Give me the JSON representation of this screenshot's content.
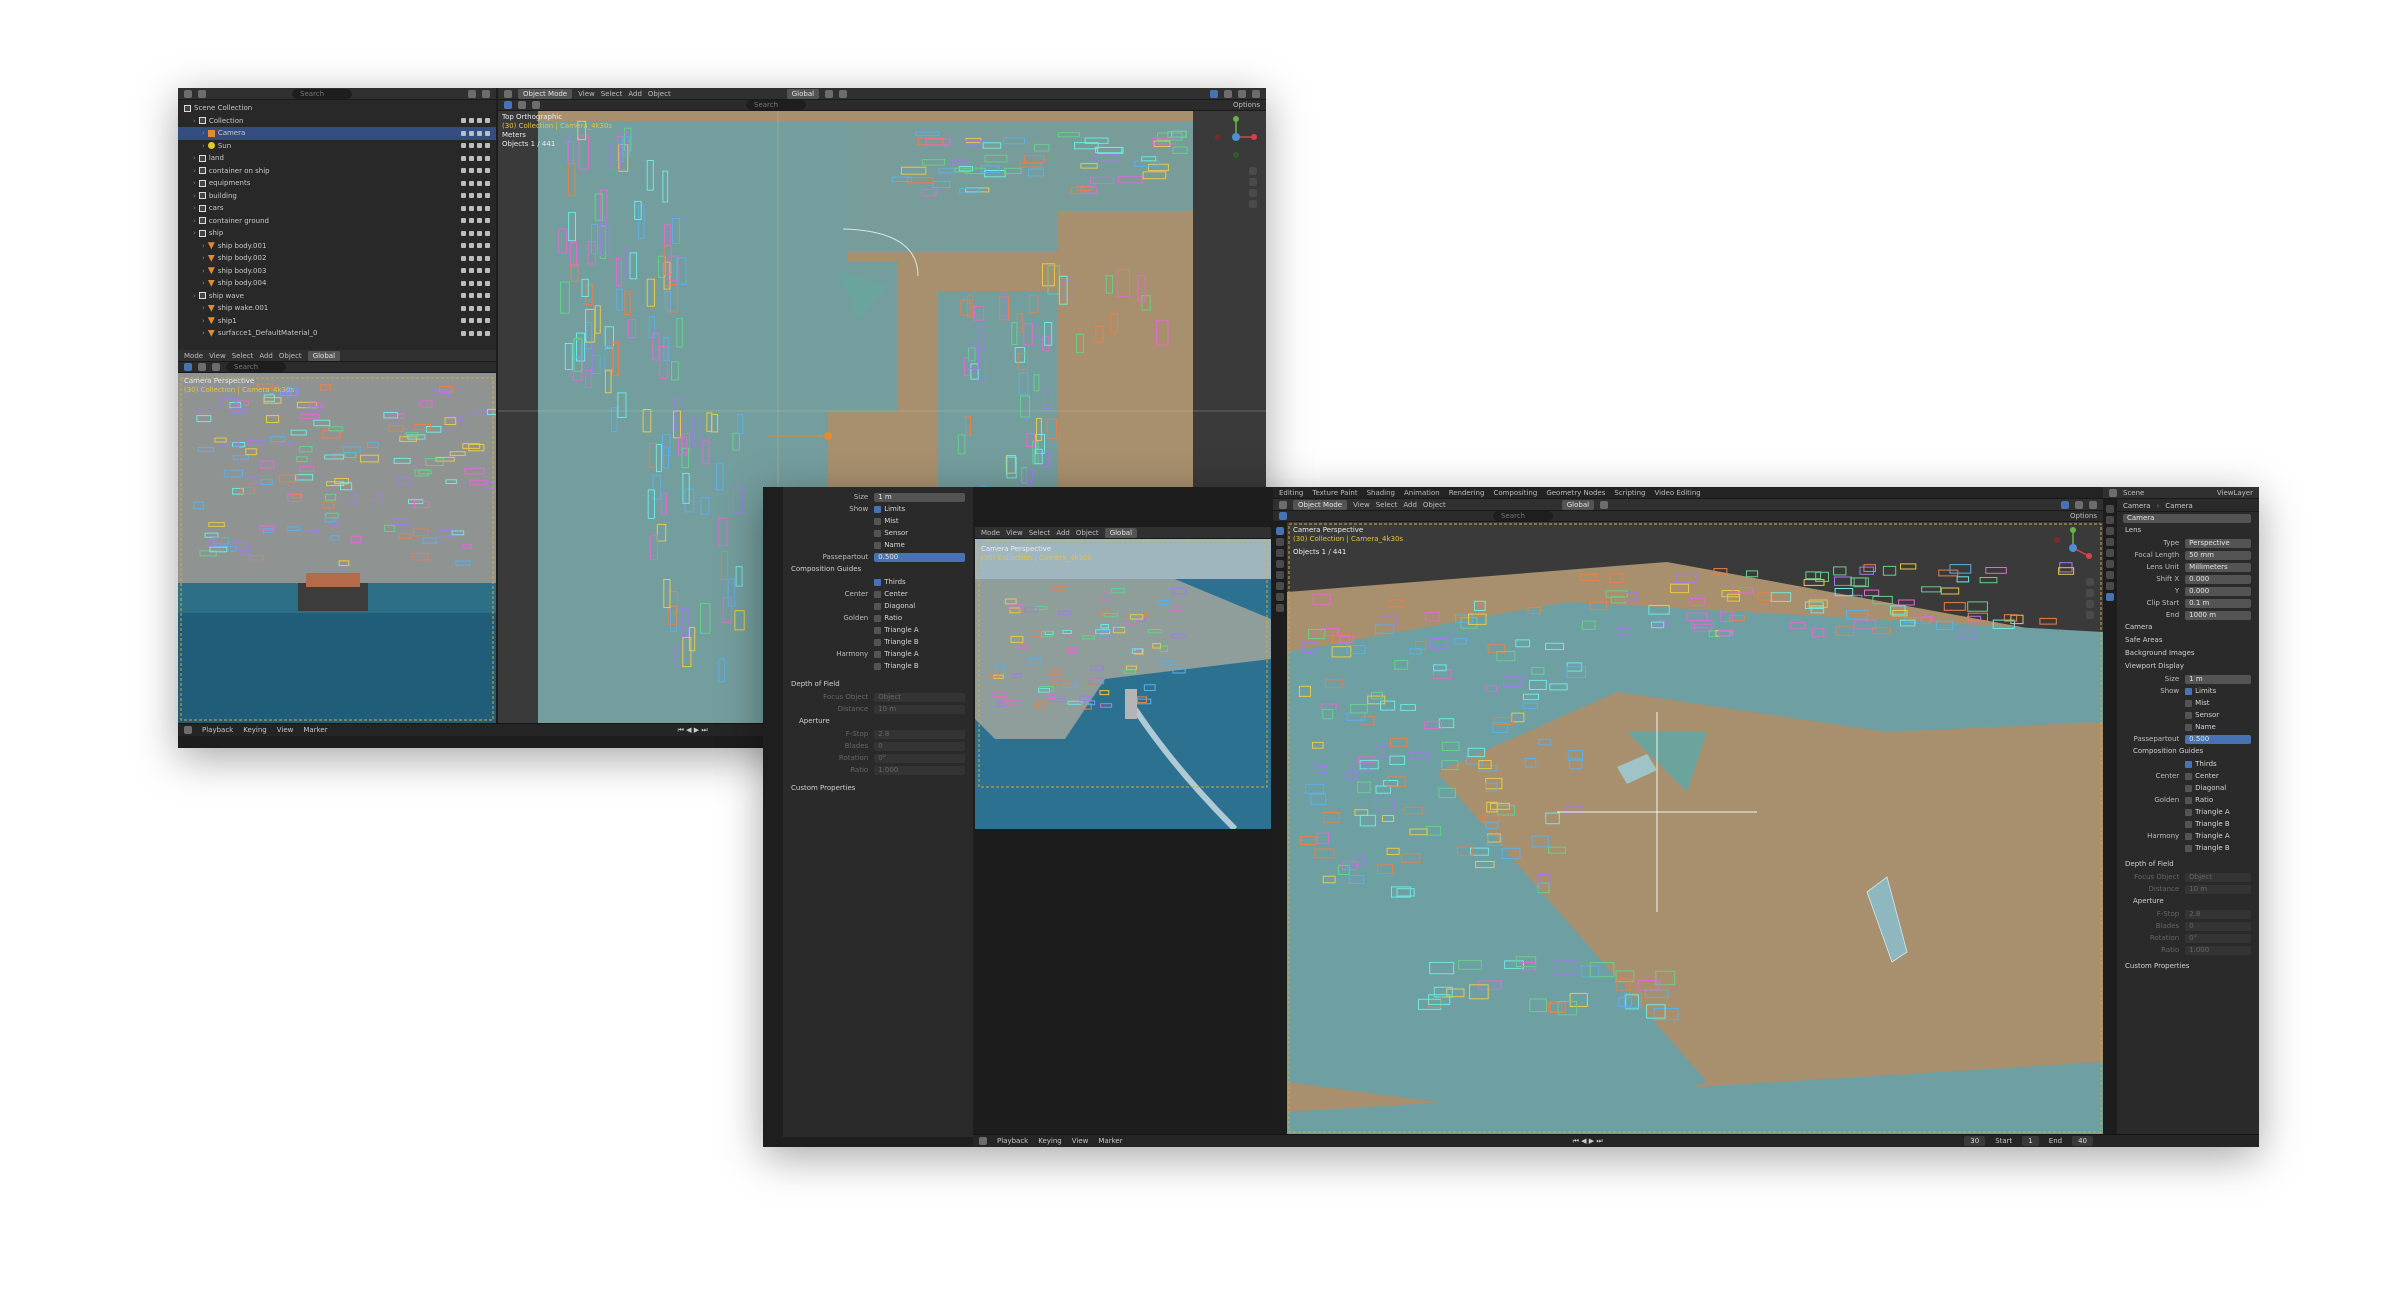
{
  "topbar": {
    "mode": "Object Mode",
    "menu": [
      "View",
      "Select",
      "Add",
      "Object"
    ],
    "orientation": "Global",
    "options": "Options",
    "search_placeholder": "Search"
  },
  "workspace_tabs": [
    "Editing",
    "Texture Paint",
    "Shading",
    "Animation",
    "Rendering",
    "Compositing",
    "Geometry Nodes",
    "Scripting",
    "Video Editing"
  ],
  "outliner": {
    "root": "Scene Collection",
    "items": [
      {
        "label": "Collection",
        "kind": "col",
        "depth": 1
      },
      {
        "label": "Camera",
        "kind": "cam",
        "depth": 2,
        "selected": true
      },
      {
        "label": "Sun",
        "kind": "sun",
        "depth": 2
      },
      {
        "label": "land",
        "kind": "col",
        "depth": 1
      },
      {
        "label": "container on ship",
        "kind": "col",
        "depth": 1
      },
      {
        "label": "equipments",
        "kind": "col",
        "depth": 1
      },
      {
        "label": "building",
        "kind": "col",
        "depth": 1
      },
      {
        "label": "cars",
        "kind": "col",
        "depth": 1
      },
      {
        "label": "container ground",
        "kind": "col",
        "depth": 1
      },
      {
        "label": "ship",
        "kind": "col",
        "depth": 1
      },
      {
        "label": "ship body.001",
        "kind": "obj",
        "depth": 2
      },
      {
        "label": "ship body.002",
        "kind": "obj",
        "depth": 2
      },
      {
        "label": "ship body.003",
        "kind": "obj",
        "depth": 2
      },
      {
        "label": "ship body.004",
        "kind": "obj",
        "depth": 2
      },
      {
        "label": "ship wave",
        "kind": "col",
        "depth": 1
      },
      {
        "label": "ship wake.001",
        "kind": "obj",
        "depth": 2
      },
      {
        "label": "ship1",
        "kind": "obj",
        "depth": 2
      },
      {
        "label": "surfacce1_DefaultMaterial_0",
        "kind": "obj",
        "depth": 2
      }
    ]
  },
  "viewport_a": {
    "view_name": "Top Orthographic",
    "collection_line": "(30) Collection | Camera_4k30s",
    "units": "Meters",
    "objects": "Objects   1 / 441"
  },
  "viewport_b": {
    "view_name": "Camera Perspective",
    "collection_line": "(30) Collection | Camera_4k30s",
    "objects": "Objects   1 / 441"
  },
  "timeline": {
    "menu": [
      "Playback",
      "Keying",
      "View",
      "Marker"
    ],
    "current_frame": "30",
    "start_label": "Start",
    "start": "1",
    "end_label": "End",
    "end": "40"
  },
  "properties": {
    "scene_label": "Scene",
    "viewlayer_label": "ViewLayer",
    "breadcrumb": [
      "Camera",
      "Camera"
    ],
    "object_name": "Camera",
    "lens_header": "Lens",
    "type_label": "Type",
    "type_value": "Perspective",
    "focal_label": "Focal Length",
    "focal_value": "50 mm",
    "lens_unit_label": "Lens Unit",
    "lens_unit_value": "Millimeters",
    "shift_x_label": "Shift X",
    "shift_x": "0.000",
    "shift_y_label": "Y",
    "shift_y": "0.000",
    "clip_start_label": "Clip Start",
    "clip_start": "0.1 m",
    "clip_end_label": "End",
    "clip_end": "1000 m",
    "camera_header": "Camera",
    "safe_areas_header": "Safe Areas",
    "bg_images_header": "Background Images",
    "viewport_display_header": "Viewport Display",
    "size_label": "Size",
    "size_value": "1 m",
    "show_label": "Show",
    "show_limits": "Limits",
    "show_mist": "Mist",
    "show_sensor": "Sensor",
    "show_name": "Name",
    "passepartout_label": "Passepartout",
    "passepartout_value": "0.500",
    "comp_guides_header": "Composition Guides",
    "thirds": "Thirds",
    "center_label": "Center",
    "center": "Center",
    "diagonal": "Diagonal",
    "golden_label": "Golden",
    "ratio": "Ratio",
    "triangle_a": "Triangle A",
    "triangle_b": "Triangle B",
    "harmony_label": "Harmony",
    "h_triangle_a": "Triangle A",
    "h_triangle_b": "Triangle B",
    "dof_header": "Depth of Field",
    "focus_object_label": "Focus Object",
    "focus_object_value": "Object",
    "distance_label": "Distance",
    "distance_value": "10 m",
    "aperture_header": "Aperture",
    "fstop_label": "F-Stop",
    "fstop_value": "2.8",
    "blades_label": "Blades",
    "blades_value": "0",
    "rotation_label": "Rotation",
    "rotation_value": "0°",
    "ratio_label": "Ratio",
    "ratio_value": "1.000",
    "custom_props_header": "Custom Properties"
  },
  "colors": {
    "ground": "#a8906e",
    "water": "#6e9fa2",
    "accent": "#4772b3",
    "panel": "#2a2a2a"
  }
}
